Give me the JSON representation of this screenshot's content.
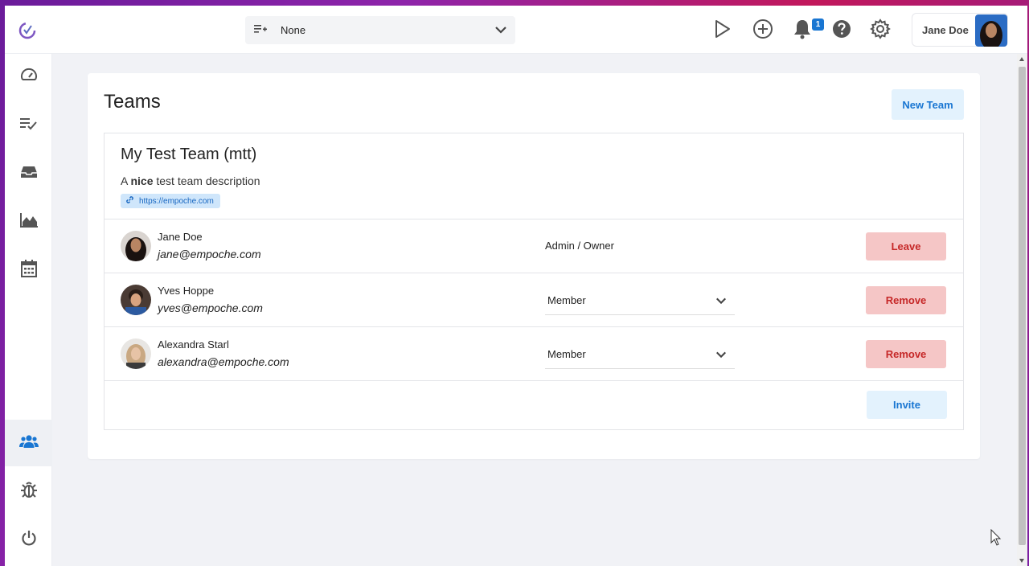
{
  "header": {
    "filter_value": "None",
    "notification_count": "1",
    "user_name": "Jane Doe"
  },
  "icons": {
    "logo": "app-logo-icon",
    "filter": "playlist-add-icon",
    "play": "play-icon",
    "add": "add-circle-icon",
    "notifications": "bell-icon",
    "help": "help-icon",
    "settings": "gear-icon"
  },
  "sidebar": {
    "items": [
      {
        "icon": "speedometer-icon"
      },
      {
        "icon": "checklist-icon"
      },
      {
        "icon": "inbox-icon"
      },
      {
        "icon": "area-chart-icon"
      },
      {
        "icon": "calendar-icon"
      },
      {
        "icon": "users-icon",
        "active": true
      },
      {
        "icon": "bug-icon"
      },
      {
        "icon": "power-icon"
      }
    ]
  },
  "page": {
    "title": "Teams",
    "new_team_label": "New Team"
  },
  "team": {
    "name": "My Test Team (mtt)",
    "desc_prefix": "A ",
    "desc_bold": "nice",
    "desc_suffix": " test team description",
    "link": "https://empoche.com",
    "members": [
      {
        "name": "Jane Doe",
        "email": "jane@empoche.com",
        "role": "Admin / Owner",
        "action": "Leave"
      },
      {
        "name": "Yves Hoppe",
        "email": "yves@empoche.com",
        "role": "Member",
        "action": "Remove"
      },
      {
        "name": "Alexandra Starl",
        "email": "alexandra@empoche.com",
        "role": "Member",
        "action": "Remove"
      }
    ],
    "invite_label": "Invite"
  },
  "colors": {
    "accent": "#1976d2",
    "danger": "#c62828",
    "danger_bg": "#f5c6c6",
    "accent_bg": "#e3f2fd"
  }
}
